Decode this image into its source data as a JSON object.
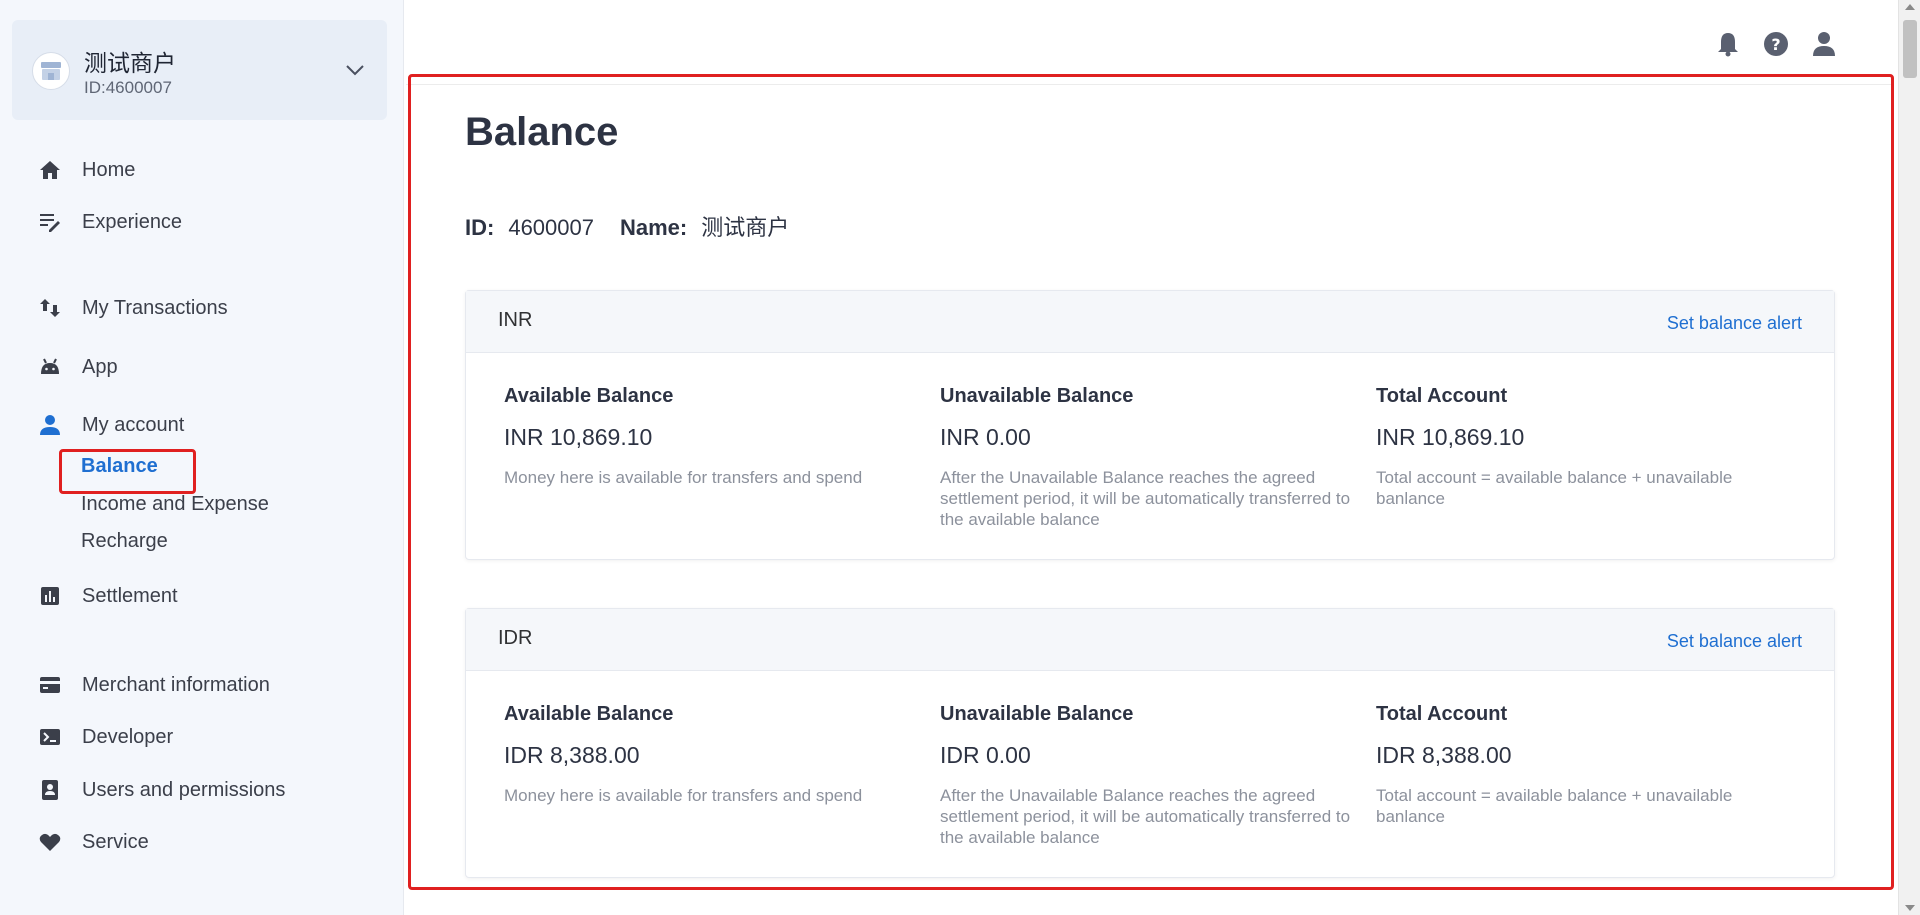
{
  "merchant": {
    "name": "测试商户",
    "id": "ID:4600007"
  },
  "nav": {
    "home": "Home",
    "experience": "Experience",
    "transactions": "My Transactions",
    "app": "App",
    "account": "My account",
    "account_sub": {
      "balance": "Balance",
      "income": "Income and Expense",
      "recharge": "Recharge"
    },
    "settlement": "Settlement",
    "merchant_info": "Merchant information",
    "developer": "Developer",
    "users": "Users and permissions",
    "service": "Service"
  },
  "page": {
    "title": "Balance",
    "id_label": "ID:",
    "id_value": "4600007",
    "name_label": "Name:",
    "name_value": "测试商户"
  },
  "cards": [
    {
      "currency": "INR",
      "alert": "Set balance alert",
      "available": {
        "title": "Available Balance",
        "amount": "INR 10,869.10",
        "desc": "Money here is available for transfers and spend"
      },
      "unavailable": {
        "title": "Unavailable Balance",
        "amount": "INR 0.00",
        "desc": "After the Unavailable Balance reaches the agreed settlement period, it will be automatically transferred to the available balance"
      },
      "total": {
        "title": "Total Account",
        "amount": "INR 10,869.10",
        "desc": "Total account = available balance + unavailable banlance"
      }
    },
    {
      "currency": "IDR",
      "alert": "Set balance alert",
      "available": {
        "title": "Available Balance",
        "amount": "IDR 8,388.00",
        "desc": "Money here is available for transfers and spend"
      },
      "unavailable": {
        "title": "Unavailable Balance",
        "amount": "IDR 0.00",
        "desc": "After the Unavailable Balance reaches the agreed settlement period, it will be automatically transferred to the available balance"
      },
      "total": {
        "title": "Total Account",
        "amount": "IDR 8,388.00",
        "desc": "Total account = available balance + unavailable banlance"
      }
    }
  ],
  "colors": {
    "accent": "#1f6fd1",
    "highlight": "#e02020",
    "sidebar_bg": "#f4f7fc"
  },
  "icons": {
    "topbar": [
      "bell-icon",
      "help-icon",
      "user-icon"
    ],
    "nav": [
      "home-icon",
      "edit-icon",
      "transfer-icon",
      "android-icon",
      "user-icon",
      "chart-icon",
      "card-icon",
      "terminal-icon",
      "contact-icon",
      "heart-icon"
    ]
  }
}
